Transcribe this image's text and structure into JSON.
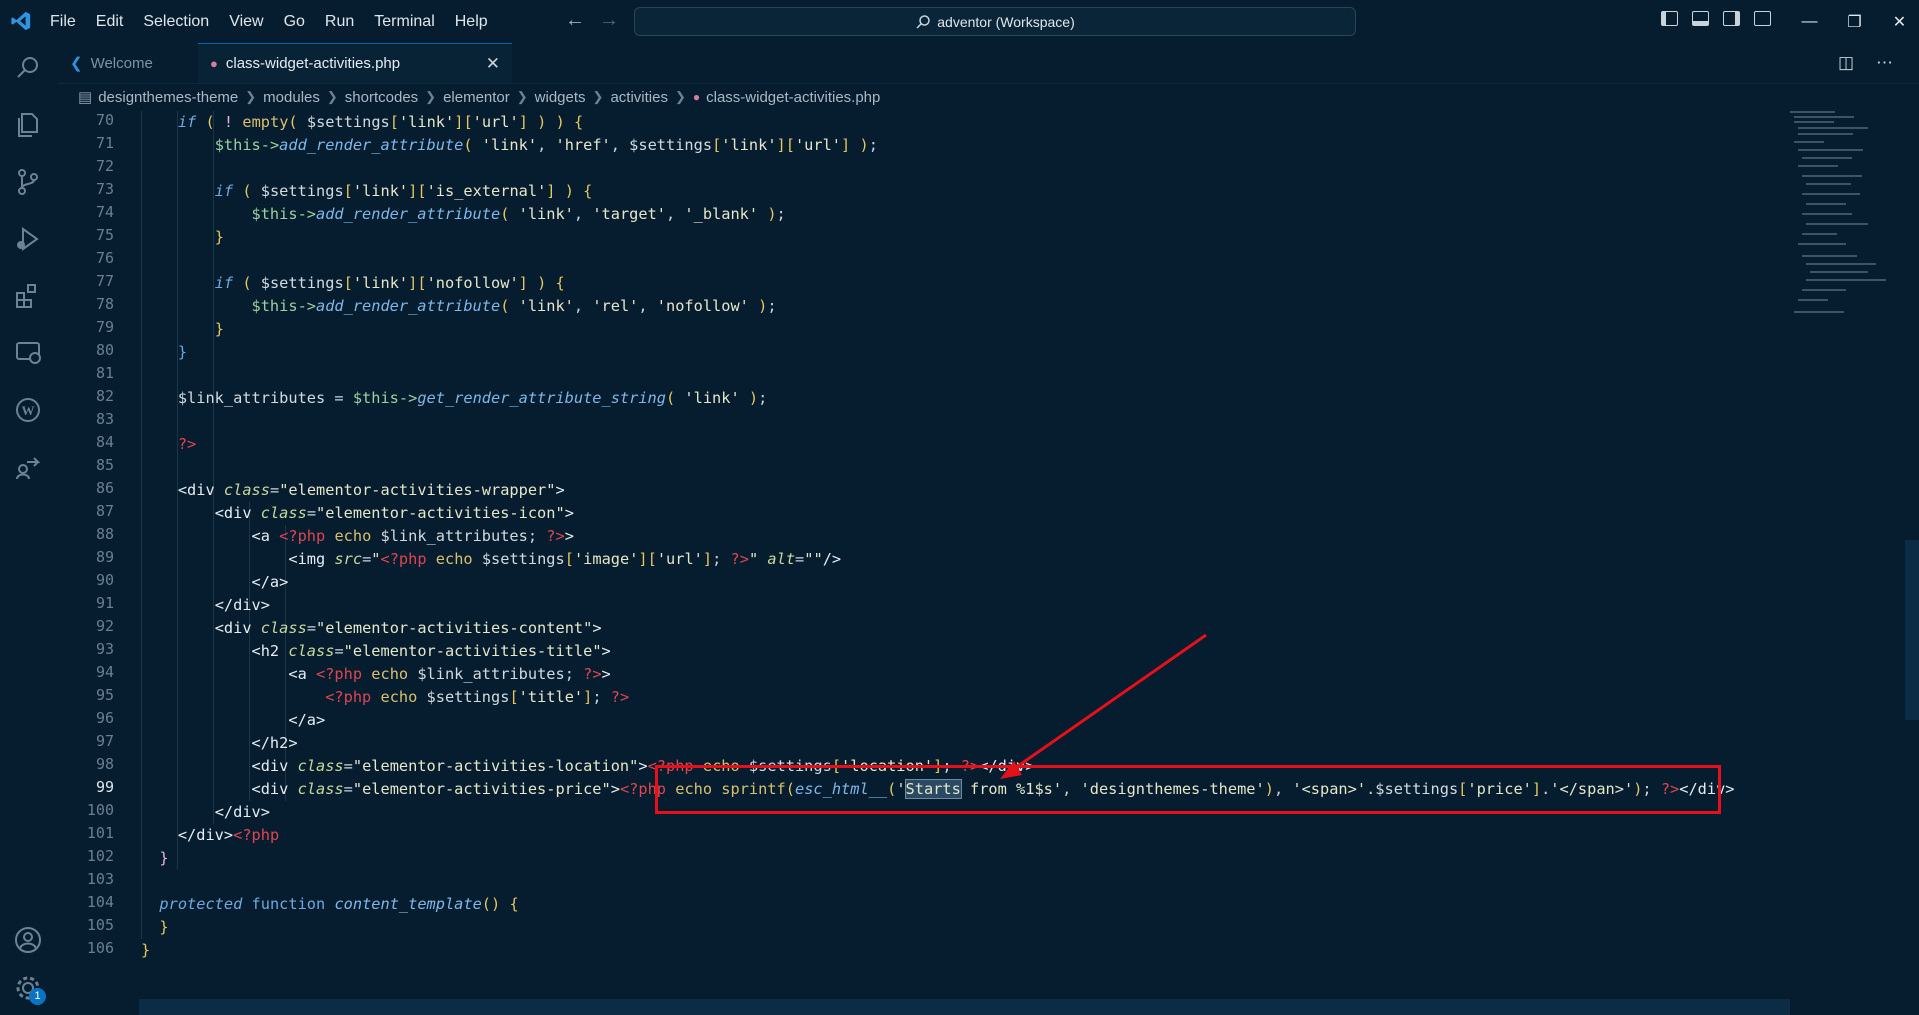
{
  "titlebar": {
    "menu": [
      "File",
      "Edit",
      "Selection",
      "View",
      "Go",
      "Run",
      "Terminal",
      "Help"
    ],
    "search": "adventor (Workspace)",
    "window_controls": [
      "minimize-icon",
      "restore-icon",
      "close-icon"
    ]
  },
  "activitybar": {
    "icons": [
      "explorer-icon",
      "search-icon",
      "source-control-icon",
      "run-debug-icon",
      "extensions-icon",
      "remote-explorer-icon",
      "wordpress-icon",
      "live-share-icon",
      "account-icon",
      "settings-gear-icon"
    ],
    "settings_badge": "1"
  },
  "tabs": [
    {
      "label": "Welcome",
      "icon": "vscode-icon",
      "active": false
    },
    {
      "label": "class-widget-activities.php",
      "icon": "php-elephant-icon",
      "active": true
    }
  ],
  "breadcrumbs": [
    "designthemes-theme",
    "modules",
    "shortcodes",
    "elementor",
    "widgets",
    "activities",
    "class-widget-activities.php"
  ],
  "editor": {
    "line_numbers": [
      "70",
      "71",
      "72",
      "73",
      "74",
      "75",
      "76",
      "77",
      "78",
      "79",
      "80",
      "81",
      "82",
      "83",
      "84",
      "85",
      "86",
      "87",
      "88",
      "89",
      "90",
      "91",
      "92",
      "93",
      "94",
      "95",
      "96",
      "97",
      "98",
      "99",
      "100",
      "101",
      "102",
      "103",
      "104",
      "105",
      "106"
    ],
    "current_line": "99"
  },
  "colors": {
    "background": "#051d2f",
    "highlight_box": "#e5101a",
    "accent": "#0066b8"
  }
}
